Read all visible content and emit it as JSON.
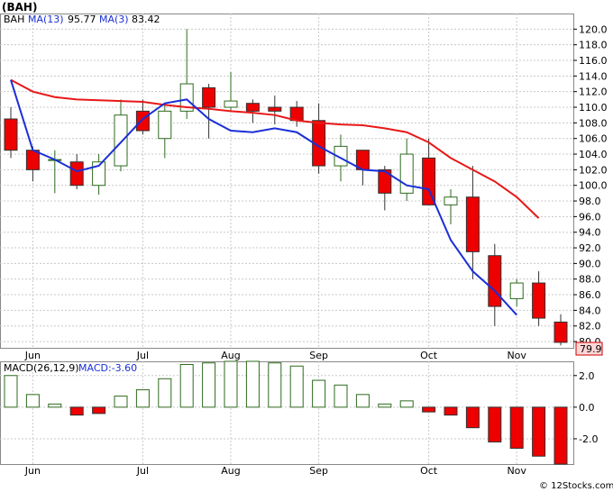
{
  "title": "(BAH)",
  "credit": "© 12Stocks.com",
  "colors": {
    "up_fill": "#ffffff",
    "up_edge": "#2e6a1e",
    "down_fill": "#ee0000",
    "down_edge": "#333333",
    "ma13": "#e81818",
    "ma3": "#1a2fd6",
    "macd_edge": "#2e6a1e",
    "macd_neg_fill": "#ee0000",
    "grid": "#c8c8c8",
    "blue_text": "#1a2fd6",
    "price_tag_bg": "#ffd6d6"
  },
  "legend": {
    "ticker": "BAH",
    "ma13_label": "MA(13)",
    "ma13_value": "95.77",
    "ma3_label": "MA(3)",
    "ma3_value": "83.42"
  },
  "macd_legend": {
    "label": "MACD(26,12,9)",
    "value_label": "MACD:-3.60"
  },
  "last_price": "79.9",
  "chart_data": [
    {
      "type": "candlestick",
      "title": "(BAH)",
      "x_labels": [
        "Jun",
        "Jul",
        "Aug",
        "Sep",
        "Oct",
        "Nov"
      ],
      "x_label_week_index": [
        1,
        6,
        10,
        14,
        19,
        23
      ],
      "y_ticks": [
        80.0,
        82.0,
        84.0,
        86.0,
        88.0,
        90.0,
        92.0,
        94.0,
        96.0,
        98.0,
        100.0,
        102.0,
        104.0,
        106.0,
        108.0,
        110.0,
        112.0,
        114.0,
        116.0,
        118.0,
        120.0
      ],
      "ylim": [
        79.2,
        122.0
      ],
      "weeks": 25,
      "candles": [
        {
          "open": 108.5,
          "high": 110.0,
          "low": 103.5,
          "close": 104.5
        },
        {
          "open": 104.5,
          "high": 105.0,
          "low": 100.5,
          "close": 102.0
        },
        {
          "open": 103.3,
          "high": 104.5,
          "low": 99.0,
          "close": 103.3
        },
        {
          "open": 103.0,
          "high": 104.0,
          "low": 99.5,
          "close": 100.0
        },
        {
          "open": 100.0,
          "high": 104.0,
          "low": 98.8,
          "close": 103.0
        },
        {
          "open": 102.5,
          "high": 111.0,
          "low": 101.8,
          "close": 109.0
        },
        {
          "open": 109.5,
          "high": 111.0,
          "low": 106.5,
          "close": 107.0
        },
        {
          "open": 106.0,
          "high": 110.5,
          "low": 103.5,
          "close": 109.5
        },
        {
          "open": 109.5,
          "high": 120.0,
          "low": 108.5,
          "close": 113.0
        },
        {
          "open": 112.5,
          "high": 113.0,
          "low": 106.0,
          "close": 110.0
        },
        {
          "open": 110.0,
          "high": 114.5,
          "low": 109.5,
          "close": 110.8
        },
        {
          "open": 110.5,
          "high": 111.0,
          "low": 108.0,
          "close": 109.5
        },
        {
          "open": 110.0,
          "high": 111.5,
          "low": 107.8,
          "close": 109.5
        },
        {
          "open": 110.0,
          "high": 110.8,
          "low": 107.5,
          "close": 108.3
        },
        {
          "open": 108.3,
          "high": 110.5,
          "low": 101.5,
          "close": 102.5
        },
        {
          "open": 102.5,
          "high": 106.5,
          "low": 100.5,
          "close": 105.0
        },
        {
          "open": 104.5,
          "high": 104.5,
          "low": 100.0,
          "close": 102.0
        },
        {
          "open": 102.0,
          "high": 102.5,
          "low": 96.8,
          "close": 99.0
        },
        {
          "open": 99.0,
          "high": 106.0,
          "low": 98.0,
          "close": 104.0
        },
        {
          "open": 103.5,
          "high": 106.0,
          "low": 97.5,
          "close": 97.5
        },
        {
          "open": 97.5,
          "high": 99.5,
          "low": 95.0,
          "close": 98.5
        },
        {
          "open": 98.5,
          "high": 102.5,
          "low": 88.0,
          "close": 91.5
        },
        {
          "open": 91.0,
          "high": 92.5,
          "low": 82.0,
          "close": 84.5
        },
        {
          "open": 85.5,
          "high": 88.0,
          "low": 84.5,
          "close": 87.5
        },
        {
          "open": 87.5,
          "high": 89.0,
          "low": 82.0,
          "close": 83.0
        },
        {
          "open": 82.5,
          "high": 83.5,
          "low": 79.5,
          "close": 79.9
        }
      ],
      "ma13": [
        {
          "i": 0,
          "v": 113.5
        },
        {
          "i": 1,
          "v": 112.0
        },
        {
          "i": 2,
          "v": 111.3
        },
        {
          "i": 3,
          "v": 111.0
        },
        {
          "i": 4,
          "v": 110.9
        },
        {
          "i": 5,
          "v": 110.8
        },
        {
          "i": 6,
          "v": 110.7
        },
        {
          "i": 7,
          "v": 110.3
        },
        {
          "i": 8,
          "v": 110.0
        },
        {
          "i": 9,
          "v": 109.8
        },
        {
          "i": 10,
          "v": 109.5
        },
        {
          "i": 11,
          "v": 109.3
        },
        {
          "i": 12,
          "v": 109.0
        },
        {
          "i": 13,
          "v": 108.3
        },
        {
          "i": 14,
          "v": 108.0
        },
        {
          "i": 15,
          "v": 107.8
        },
        {
          "i": 16,
          "v": 107.7
        },
        {
          "i": 17,
          "v": 107.3
        },
        {
          "i": 18,
          "v": 106.8
        },
        {
          "i": 19,
          "v": 105.5
        },
        {
          "i": 20,
          "v": 103.5
        },
        {
          "i": 21,
          "v": 102.0
        },
        {
          "i": 22,
          "v": 100.5
        },
        {
          "i": 23,
          "v": 98.5
        },
        {
          "i": 24,
          "v": 95.8
        }
      ],
      "ma3": [
        {
          "i": 0,
          "v": 113.5
        },
        {
          "i": 1,
          "v": 104.5
        },
        {
          "i": 2,
          "v": 103.3
        },
        {
          "i": 3,
          "v": 101.8
        },
        {
          "i": 4,
          "v": 102.5
        },
        {
          "i": 5,
          "v": 105.5
        },
        {
          "i": 6,
          "v": 108.5
        },
        {
          "i": 7,
          "v": 110.5
        },
        {
          "i": 8,
          "v": 111.0
        },
        {
          "i": 9,
          "v": 108.5
        },
        {
          "i": 10,
          "v": 107.0
        },
        {
          "i": 11,
          "v": 106.8
        },
        {
          "i": 12,
          "v": 107.3
        },
        {
          "i": 13,
          "v": 106.8
        },
        {
          "i": 14,
          "v": 105.0
        },
        {
          "i": 15,
          "v": 103.5
        },
        {
          "i": 16,
          "v": 102.0
        },
        {
          "i": 17,
          "v": 101.8
        },
        {
          "i": 18,
          "v": 100.0
        },
        {
          "i": 19,
          "v": 99.5
        },
        {
          "i": 20,
          "v": 93.0
        },
        {
          "i": 21,
          "v": 89.0
        },
        {
          "i": 22,
          "v": 86.5
        },
        {
          "i": 23,
          "v": 83.4
        }
      ],
      "ma13_start_week": 0,
      "ma3_start_week": 3
    },
    {
      "type": "bar",
      "title": "MACD(26,12,9)",
      "y_ticks": [
        2.0,
        0.0,
        -2.0
      ],
      "ylim": [
        -3.6,
        2.9
      ],
      "values": [
        2.0,
        0.8,
        0.2,
        -0.5,
        -0.4,
        0.7,
        1.1,
        1.8,
        2.7,
        2.8,
        2.9,
        2.9,
        2.8,
        2.6,
        1.7,
        1.4,
        0.8,
        0.2,
        0.4,
        -0.3,
        -0.5,
        -1.3,
        -2.2,
        -2.6,
        -3.1,
        -3.6
      ]
    }
  ]
}
